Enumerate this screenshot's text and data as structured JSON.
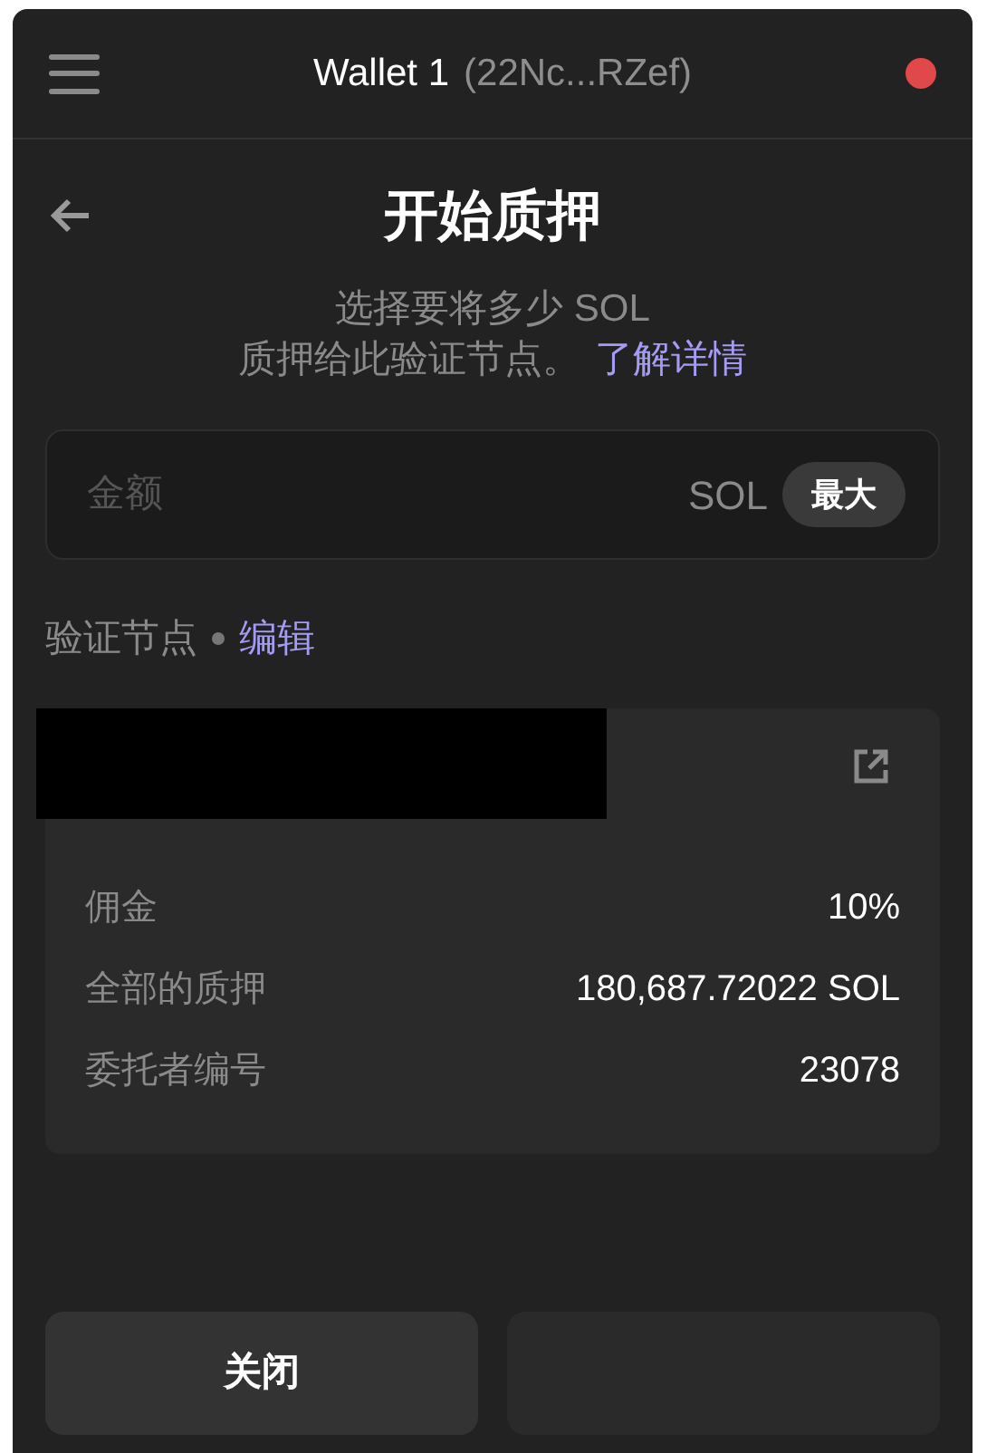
{
  "header": {
    "wallet_name": "Wallet 1",
    "address": "(22Nc...RZef)",
    "status_dot": {
      "color": "#e0484a"
    }
  },
  "title": "开始质押",
  "description": {
    "line_1": "选择要将多少 SOL",
    "line_2": "质押给此验证节点。",
    "link": "了解详情"
  },
  "amount_field": {
    "placeholder": "金额",
    "unit": "SOL",
    "max_button": "最大"
  },
  "validator_section": {
    "label": "验证节点",
    "edit_link": "编辑"
  },
  "validator_details": [
    {
      "label": "佣金",
      "value": "10%"
    },
    {
      "label": "全部的质押",
      "value": "180,687.72022 SOL"
    },
    {
      "label": "委托者编号",
      "value": "23078"
    }
  ],
  "buttons": [
    {
      "label": "关闭"
    }
  ]
}
